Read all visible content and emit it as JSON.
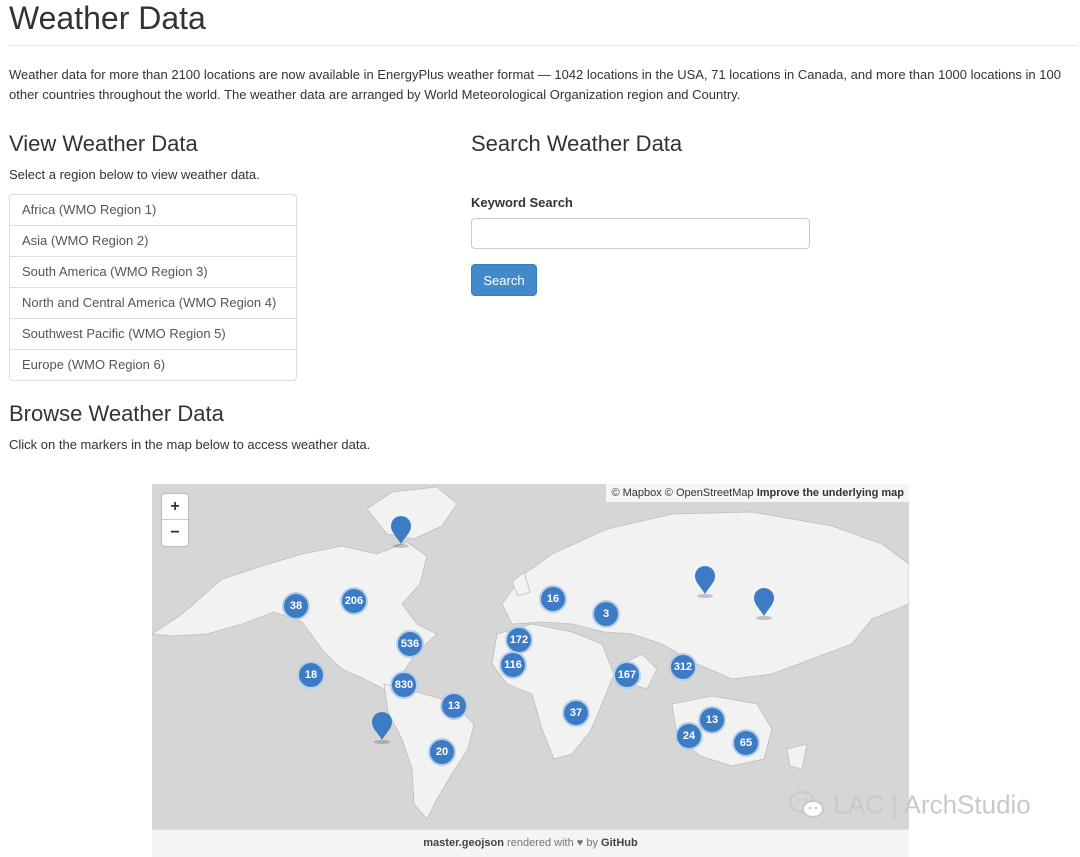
{
  "page": {
    "title": "Weather Data",
    "intro": "Weather data for more than 2100 locations are now available in EnergyPlus weather format — 1042 locations in the USA, 71 locations in Canada, and more than 1000 locations in 100 other countries throughout the world. The weather data are arranged by World Meteorological Organization region and Country."
  },
  "view": {
    "heading": "View Weather Data",
    "subtext": "Select a region below to view weather data.",
    "regions": [
      "Africa (WMO Region 1)",
      "Asia (WMO Region 2)",
      "South America (WMO Region 3)",
      "North and Central America (WMO Region 4)",
      "Southwest Pacific (WMO Region 5)",
      "Europe (WMO Region 6)"
    ]
  },
  "search": {
    "heading": "Search Weather Data",
    "label": "Keyword Search",
    "value": "",
    "button": "Search"
  },
  "browse": {
    "heading": "Browse Weather Data",
    "subtext": "Click on the markers in the map below to access weather data."
  },
  "map": {
    "zoom_in": "+",
    "zoom_out": "−",
    "attribution_pre": "© Mapbox © OpenStreetMap",
    "attribution_link": "Improve the underlying map",
    "footer_file": "master.geojson",
    "footer_mid": "rendered with",
    "footer_heart": "♥",
    "footer_by": "by",
    "footer_link": "GitHub",
    "marker_color": "#3d7bc4",
    "clusters": [
      "38",
      "206",
      "536",
      "18",
      "830",
      "13",
      "20",
      "16",
      "3",
      "172",
      "116",
      "167",
      "312",
      "37",
      "13",
      "24",
      "65"
    ]
  },
  "watermark": {
    "text": "LAC | ArchStudio",
    "icon": "wechat-icon"
  }
}
